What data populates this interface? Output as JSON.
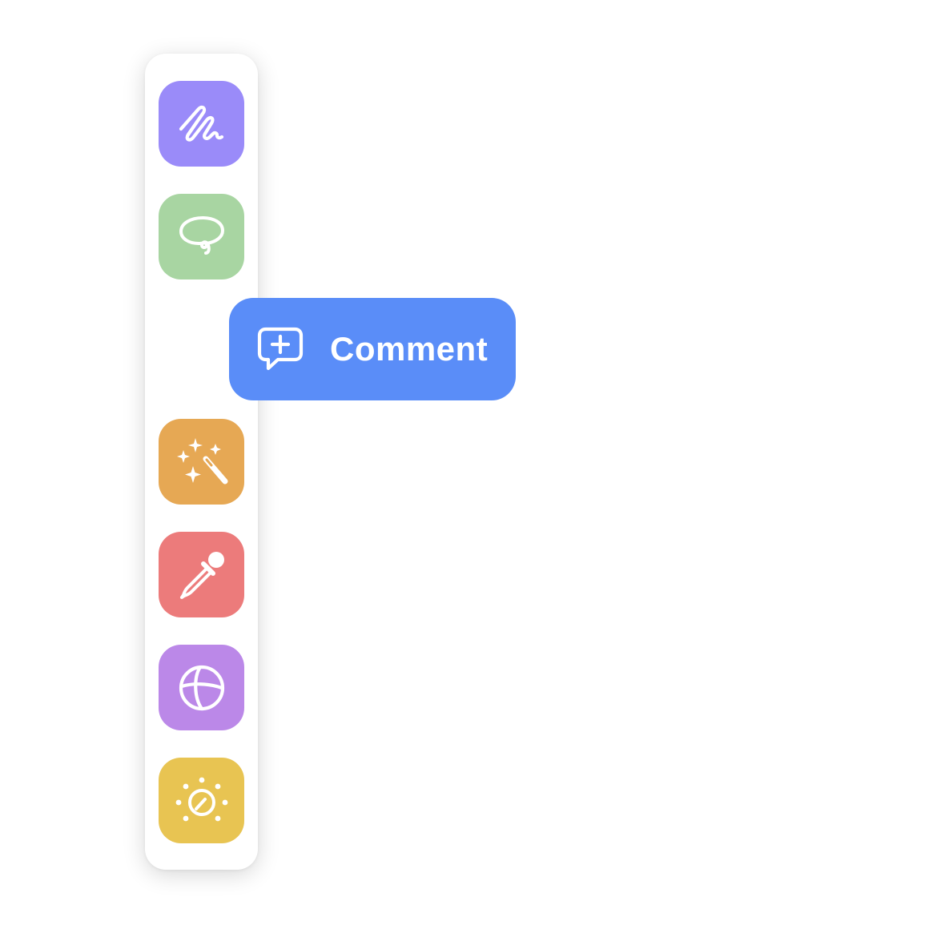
{
  "toolbar": {
    "tools": [
      {
        "name": "scribble",
        "icon": "scribble-icon",
        "color": "#9A8BF9"
      },
      {
        "name": "lasso",
        "icon": "lasso-icon",
        "color": "#A8D5A2"
      },
      {
        "name": "magic",
        "icon": "magic-wand-icon",
        "color": "#E6A854"
      },
      {
        "name": "eyedropper",
        "icon": "eyedropper-icon",
        "color": "#EC7B7B"
      },
      {
        "name": "globe",
        "icon": "globe-icon",
        "color": "#BB88E8"
      },
      {
        "name": "brightness",
        "icon": "brightness-dial-icon",
        "color": "#E8C452"
      }
    ],
    "active_tool": {
      "name": "comment",
      "icon": "comment-add-icon",
      "label": "Comment",
      "color": "#5A8DF8"
    }
  }
}
